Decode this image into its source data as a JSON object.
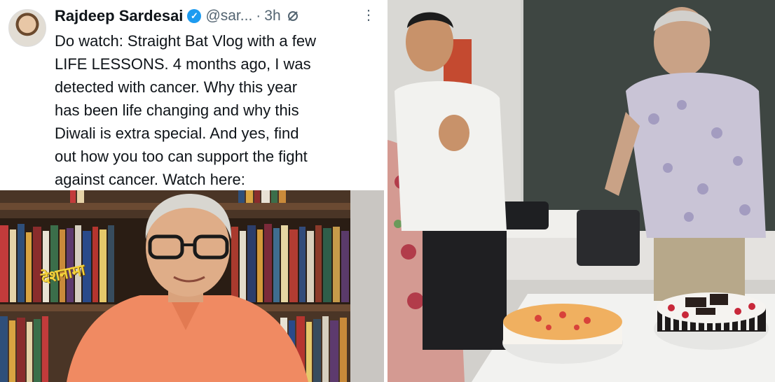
{
  "tweet": {
    "author_name": "Rajdeep Sardesai",
    "handle": "@sar...",
    "separator": "·",
    "time": "3h",
    "text": "Do watch: Straight Bat Vlog with a few\nLIFE LESSONS. 4 months ago, I was\ndetected with cancer. Why this year\nhas been life changing and why  this\nDiwali is extra special. And yes, find\nout how you too can support the fight\nagainst cancer. Watch here:",
    "more_glyph": "⋮"
  },
  "video_thumbnail": {
    "watermark": "देशनामा"
  },
  "icons": {
    "verified": "verified-badge-icon",
    "mute": "mute-icon",
    "more": "more-options-icon"
  },
  "colors": {
    "verified_blue": "#1d9bf0",
    "text_primary": "#0f1419",
    "text_secondary": "#536471",
    "kurta_orange": "#f08a62"
  }
}
